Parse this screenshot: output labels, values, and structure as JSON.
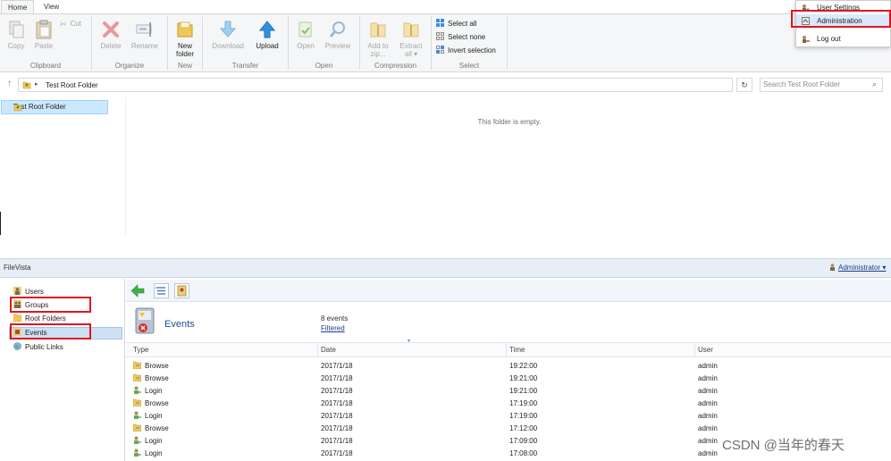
{
  "ribbon": {
    "tabs": [
      "Home",
      "View"
    ],
    "clipboard": {
      "copy": "Copy",
      "paste": "Paste",
      "cut": "Cut",
      "label": "Clipboard"
    },
    "organize": {
      "delete": "Delete",
      "rename": "Rename",
      "label": "Organize"
    },
    "new": {
      "new_folder_1": "New",
      "new_folder_2": "folder",
      "label": "New"
    },
    "transfer": {
      "download": "Download",
      "upload": "Upload",
      "label": "Transfer"
    },
    "open": {
      "open": "Open",
      "preview": "Preview",
      "label": "Open"
    },
    "compression": {
      "add_1": "Add to",
      "add_2": "zip...",
      "extract_1": "Extract",
      "extract_2": "all ▾",
      "label": "Compression"
    },
    "select": {
      "select_all": "Select all",
      "select_none": "Select none",
      "invert": "Invert selection",
      "label": "Select"
    }
  },
  "address": {
    "path": "Test Root Folder",
    "search_placeholder": "Search Test Root Folder"
  },
  "tree": {
    "root": "Test Root Folder"
  },
  "content": {
    "empty_message": "This folder is empty."
  },
  "user_menu": {
    "items": [
      "User Settings",
      "Administration",
      "Log out"
    ]
  },
  "filevista": {
    "title": "FileVista",
    "user": "Administrator ▾",
    "nav": [
      "Users",
      "Groups",
      "Root Folders",
      "Events",
      "Public Links"
    ],
    "events": {
      "title": "Events",
      "count": "8 events",
      "filter": "Filtered",
      "columns": [
        "Type",
        "Date",
        "Time",
        "User"
      ],
      "rows": [
        [
          "Browse",
          "2017/1/18",
          "19:22:00",
          "admin"
        ],
        [
          "Browse",
          "2017/1/18",
          "19:21:00",
          "admin"
        ],
        [
          "Login",
          "2017/1/18",
          "19:21:00",
          "admin"
        ],
        [
          "Browse",
          "2017/1/18",
          "17:19:00",
          "admin"
        ],
        [
          "Login",
          "2017/1/18",
          "17:19:00",
          "admin"
        ],
        [
          "Browse",
          "2017/1/18",
          "17:12:00",
          "admin"
        ],
        [
          "Login",
          "2017/1/18",
          "17:09:00",
          "admin"
        ],
        [
          "Login",
          "2017/1/18",
          "17:08:00",
          "admin"
        ]
      ]
    }
  },
  "watermark": "CSDN @当年的春天",
  "colors": {
    "highlight_red": "#e1141e",
    "selection_blue": "#cce8ff",
    "link_blue": "#1a3c88"
  }
}
